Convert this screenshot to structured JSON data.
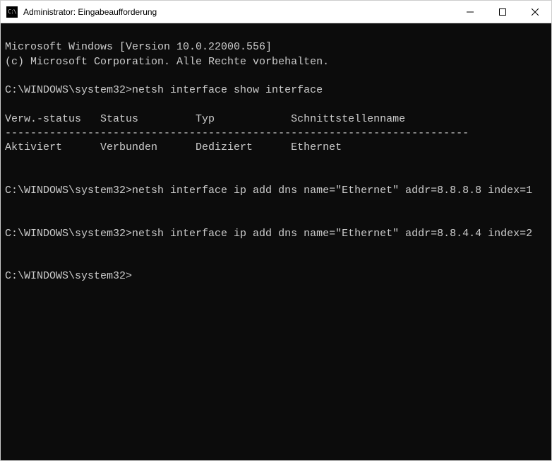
{
  "window": {
    "title": "Administrator: Eingabeaufforderung"
  },
  "terminal": {
    "line1": "Microsoft Windows [Version 10.0.22000.556]",
    "line2": "(c) Microsoft Corporation. Alle Rechte vorbehalten.",
    "blank1": "",
    "prompt1": "C:\\WINDOWS\\system32>netsh interface show interface",
    "blank2": "",
    "header": "Verw.-status   Status         Typ            Schnittstellenname",
    "divider": "-------------------------------------------------------------------------",
    "row1": "Aktiviert      Verbunden      Dediziert      Ethernet",
    "blank3": "",
    "blank4": "",
    "prompt2": "C:\\WINDOWS\\system32>netsh interface ip add dns name=\"Ethernet\" addr=8.8.8.8 index=1",
    "blank5": "",
    "blank6": "",
    "prompt3": "C:\\WINDOWS\\system32>netsh interface ip add dns name=\"Ethernet\" addr=8.8.4.4 index=2",
    "blank7": "",
    "blank8": "",
    "prompt4": "C:\\WINDOWS\\system32>"
  }
}
